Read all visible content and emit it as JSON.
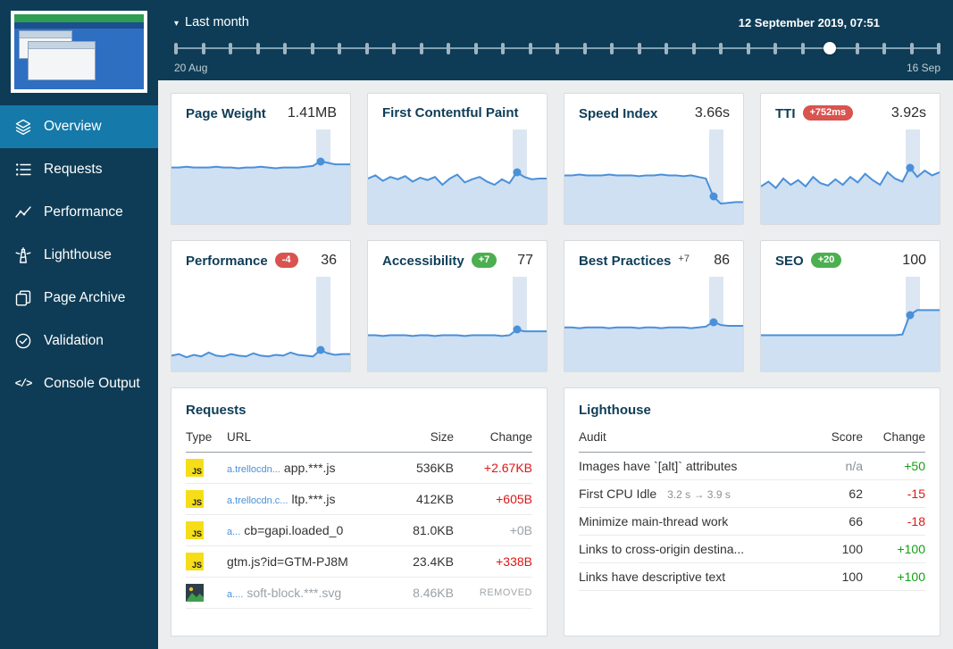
{
  "icons": {
    "caret_down": "▾",
    "console_glyph": "</>",
    "js_label": "JS"
  },
  "sidebar": {
    "items": [
      {
        "label": "Overview"
      },
      {
        "label": "Requests"
      },
      {
        "label": "Performance"
      },
      {
        "label": "Lighthouse"
      },
      {
        "label": "Page Archive"
      },
      {
        "label": "Validation"
      },
      {
        "label": "Console Output"
      }
    ]
  },
  "topbar": {
    "range_label": "Last month",
    "date_label": "12 September 2019, 07:51",
    "start_label": "20 Aug",
    "end_label": "16 Sep",
    "tick_count": 29,
    "slider_position": 0.855
  },
  "sparkline": {
    "selection": 0.85,
    "stroke": "#4a90d9",
    "fill": "#cfe0f2"
  },
  "cards": [
    {
      "title": "Page Weight",
      "value": "1.41MB",
      "points": [
        72,
        72,
        73,
        72,
        72,
        72,
        73,
        72,
        72,
        71,
        72,
        72,
        73,
        72,
        71,
        72,
        72,
        72,
        73,
        74,
        80,
        78,
        76,
        76,
        76
      ]
    },
    {
      "title": "First Contentful Paint",
      "value": "",
      "points": [
        58,
        62,
        55,
        60,
        57,
        61,
        54,
        59,
        56,
        60,
        50,
        58,
        63,
        53,
        57,
        60,
        54,
        50,
        57,
        52,
        66,
        60,
        57,
        58,
        58
      ]
    },
    {
      "title": "Speed Index",
      "value": "3.66s",
      "points": [
        62,
        62,
        63,
        62,
        62,
        62,
        63,
        62,
        62,
        62,
        61,
        62,
        62,
        63,
        62,
        62,
        61,
        62,
        60,
        58,
        35,
        26,
        27,
        28,
        28
      ]
    },
    {
      "title": "TTI",
      "badge": "+752ms",
      "badge_color": "#d9534f",
      "value": "3.92s",
      "points": [
        48,
        54,
        46,
        58,
        50,
        56,
        48,
        60,
        52,
        49,
        57,
        50,
        60,
        53,
        64,
        56,
        50,
        66,
        58,
        54,
        72,
        60,
        68,
        62,
        66
      ]
    },
    {
      "title": "Performance",
      "badge": "-4",
      "badge_color": "#d9534f",
      "value": "36",
      "points": [
        20,
        22,
        18,
        21,
        19,
        24,
        20,
        19,
        22,
        20,
        19,
        23,
        20,
        19,
        21,
        20,
        24,
        21,
        20,
        19,
        27,
        23,
        21,
        22,
        22
      ]
    },
    {
      "title": "Accessibility",
      "badge": "+7",
      "badge_color": "#4caf50",
      "value": "77",
      "points": [
        46,
        46,
        45,
        46,
        46,
        46,
        45,
        46,
        46,
        45,
        46,
        46,
        46,
        45,
        46,
        46,
        46,
        46,
        45,
        46,
        53,
        51,
        51,
        51,
        51
      ]
    },
    {
      "title": "Best Practices",
      "badge_plain": "+7",
      "value": "86",
      "points": [
        56,
        56,
        55,
        56,
        56,
        56,
        55,
        56,
        56,
        56,
        55,
        56,
        56,
        55,
        56,
        56,
        56,
        55,
        56,
        57,
        63,
        59,
        58,
        58,
        58
      ]
    },
    {
      "title": "SEO",
      "badge": "+20",
      "badge_color": "#4caf50",
      "value": "100",
      "points": [
        46,
        46,
        46,
        46,
        46,
        46,
        46,
        46,
        46,
        46,
        46,
        46,
        46,
        46,
        46,
        46,
        46,
        46,
        46,
        47,
        72,
        78,
        78,
        78,
        78
      ]
    }
  ],
  "requests": {
    "title": "Requests",
    "columns": [
      "Type",
      "URL",
      "Size",
      "Change"
    ],
    "rows": [
      {
        "type": "JS",
        "prefix": "a.trellocdn...",
        "url": "app.***.js",
        "size": "536KB",
        "change": "+2.67KB"
      },
      {
        "type": "JS",
        "prefix": "a.trellocdn.c...",
        "url": "ltp.***.js",
        "size": "412KB",
        "change": "+605B"
      },
      {
        "type": "JS",
        "prefix": "a...",
        "url": "cb=gapi.loaded_0",
        "size": "81.0KB",
        "change": "+0B"
      },
      {
        "type": "JS",
        "prefix": "",
        "url": "gtm.js?id=GTM-PJ8M",
        "size": "23.4KB",
        "change": "+338B"
      },
      {
        "type": "image",
        "prefix": "a....",
        "url": "soft-block.***.svg",
        "size": "8.46KB",
        "change": "REMOVED"
      }
    ]
  },
  "lighthouse": {
    "title": "Lighthouse",
    "columns": [
      "Audit",
      "Score",
      "Change"
    ],
    "rows": [
      {
        "audit": "Images have `[alt]` attributes",
        "score": "n/a",
        "change": "+50"
      },
      {
        "audit": "First CPU Idle",
        "detail": "3.2 s → 3.9 s",
        "score": "62",
        "change": "-15"
      },
      {
        "audit": "Minimize main-thread work",
        "score": "66",
        "change": "-18"
      },
      {
        "audit": "Links to cross-origin destina...",
        "score": "100",
        "change": "+100"
      },
      {
        "audit": "Links have descriptive text",
        "score": "100",
        "change": "+100"
      }
    ]
  },
  "theme": {
    "sidebar_bg": "#0e3c56",
    "active_item_bg": "#1579a9",
    "heading_navy": "#0e3d57",
    "spark_line": "#4a90d9",
    "spark_fill": "#cfe0f2",
    "badge_red": "#d9534f",
    "badge_green": "#4caf50",
    "text_red": "#e01515",
    "text_green": "#13a013"
  }
}
